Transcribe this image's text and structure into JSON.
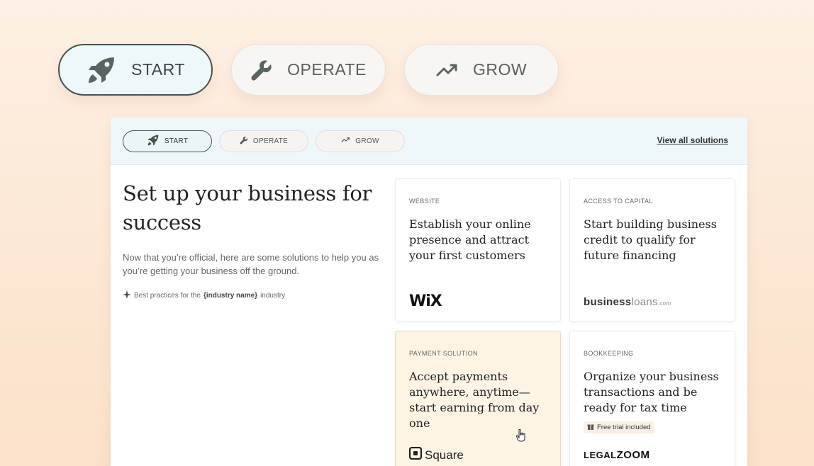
{
  "hero_tabs": [
    {
      "label": "START",
      "icon": "rocket-icon",
      "active": true
    },
    {
      "label": "OPERATE",
      "icon": "wrench-icon",
      "active": false
    },
    {
      "label": "GROW",
      "icon": "trending-up-icon",
      "active": false
    }
  ],
  "panel": {
    "tabs": [
      {
        "label": "START",
        "icon": "rocket-icon",
        "active": true
      },
      {
        "label": "OPERATE",
        "icon": "wrench-icon",
        "active": false
      },
      {
        "label": "GROW",
        "icon": "trending-up-icon",
        "active": false
      }
    ],
    "view_all": "View all solutions"
  },
  "intro": {
    "title": "Set up your business for success",
    "body": "Now that you’re official, here are some solutions to help you as you’re getting your business off the ground.",
    "best_prefix": "Best practices for the",
    "best_bold": "{industry name}",
    "best_suffix": "industry"
  },
  "tiles": [
    {
      "eyebrow": "WEBSITE",
      "heading": "Establish your online presence and attract your first customers",
      "logo": "WiX"
    },
    {
      "eyebrow": "ACCESS TO CAPITAL",
      "heading": "Start building business credit to qualify for future financing",
      "logo_a": "business",
      "logo_b": "loans",
      "logo_c": ".com"
    },
    {
      "eyebrow": "PAYMENT SOLUTION",
      "heading": "Accept payments anywhere, anytime—start earning from day one",
      "logo": "Square"
    },
    {
      "eyebrow": "BOOKKEEPING",
      "heading": "Organize your business transactions and be ready for tax time",
      "badge": "Free trial included",
      "logo_a": "LEGAL",
      "logo_b": "ZOOM"
    }
  ],
  "colors": {
    "accent_bg": "#eef8fb",
    "highlight_tile": "#fdf4e4",
    "page_bg": "#fbe6d0"
  }
}
